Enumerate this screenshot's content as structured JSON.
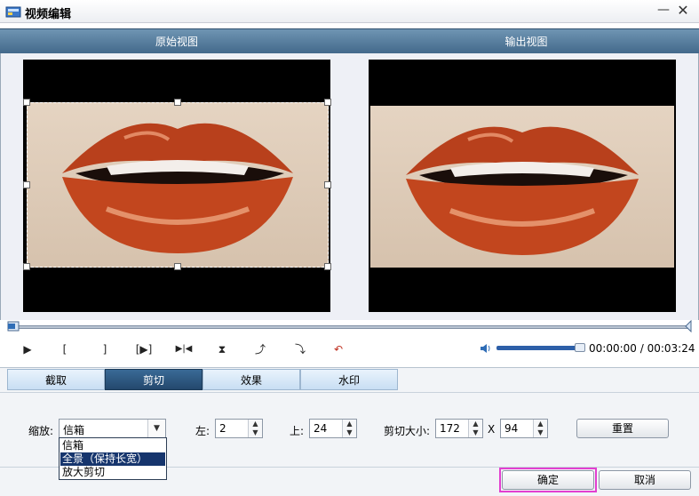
{
  "window": {
    "title": "视频编辑",
    "minimize_glyph": "—",
    "close_glyph": "✕"
  },
  "preview": {
    "original_label": "原始视图",
    "output_label": "输出视图"
  },
  "playback": {
    "controls": [
      {
        "name": "play-button",
        "glyph": "▶"
      },
      {
        "name": "mark-in-button",
        "glyph": "["
      },
      {
        "name": "mark-out-button",
        "glyph": "]"
      },
      {
        "name": "play-selection-button",
        "glyph": "[▶]"
      },
      {
        "name": "next-frame-button",
        "glyph": "▶|◀"
      },
      {
        "name": "flip-vertical-button",
        "glyph": "⧗"
      },
      {
        "name": "rotate-right-button",
        "glyph": "⤴"
      },
      {
        "name": "rotate-left-button",
        "glyph": "⤵"
      },
      {
        "name": "undo-button",
        "glyph": "↶"
      }
    ],
    "time": "00:00:00 / 00:03:24",
    "volume_level": 0.93,
    "seek_position": 0.0
  },
  "tabs": [
    {
      "label": "截取",
      "active": false
    },
    {
      "label": "剪切",
      "active": true
    },
    {
      "label": "效果",
      "active": false
    },
    {
      "label": "水印",
      "active": false
    }
  ],
  "crop": {
    "zoom_label": "缩放:",
    "zoom_value": "信箱",
    "zoom_options": [
      "信箱",
      "全景（保持长宽）",
      "放大剪切"
    ],
    "zoom_options_selected_index": 1,
    "left_label": "左:",
    "left_value": "2",
    "top_label": "上:",
    "top_value": "24",
    "size_label": "剪切大小:",
    "width_value": "172",
    "times_sign": "X",
    "height_value": "94",
    "reset_label": "重置"
  },
  "footer": {
    "ok_label": "确定",
    "cancel_label": "取消"
  },
  "colors": {
    "header_blue": "#4a7090",
    "active_tab": "#2b5075",
    "ok_highlight": "#e23fd0",
    "lip_red": "#b8401c"
  }
}
